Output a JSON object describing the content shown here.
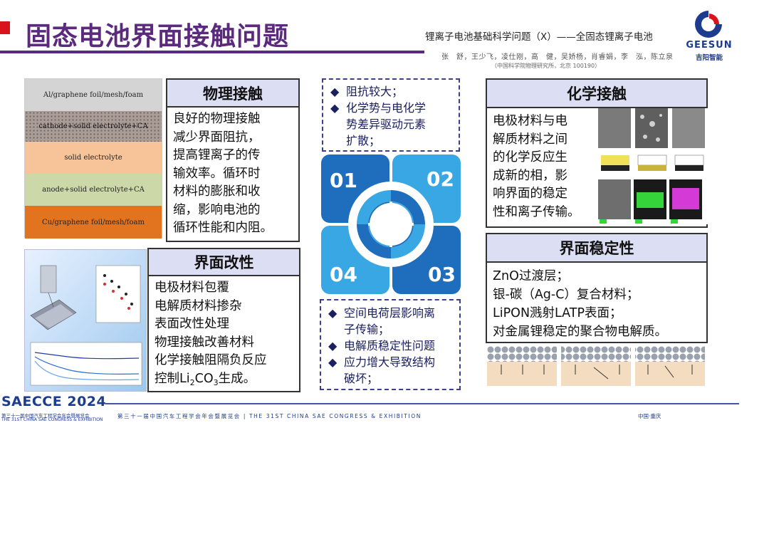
{
  "header": {
    "title": "固态电池界面接触问题",
    "paper_title": "锂离子电池基础科学问题（X）——全固态锂离子电池",
    "authors": "张　舒，王少飞，凌仕刚，高　健，吴娇杨，肖睿娟，李　泓，陈立泉",
    "affiliation": "（中国科学院物理研究所，北京 100190）"
  },
  "logo": {
    "name": "GEESUN",
    "cn": "吉阳智能",
    "colors": {
      "blue": "#1d3c8f",
      "red": "#d9141c"
    }
  },
  "layer_stack": {
    "layers": [
      "Al/graphene foil/mesh/foam",
      "cathode+solid electrolyte+CA",
      "solid electrolyte",
      "anode+solid electrolyte+CA",
      "Cu/graphene foil/mesh/foam"
    ]
  },
  "physical_contact": {
    "heading": "物理接触",
    "lines": [
      "良好的物理接触",
      "减少界面阻抗，",
      "提高锂离子的传",
      "输效率。循环时",
      "材料的膨胀和收",
      "缩，影响电池的",
      "循环性能和内阻。"
    ]
  },
  "surface_mod": {
    "heading": "界面改性",
    "lines": [
      "电极材料包覆",
      "电解质材料掺杂",
      "表面改性处理",
      "物理接触改善材料",
      "化学接触阻隔负反应"
    ],
    "last_line_prefix": "控制Li",
    "last_sub_2": "2",
    "last_mid": "CO",
    "last_sub_3": "3",
    "last_suffix": "生成。"
  },
  "top_issues": {
    "bullet": "◆",
    "items": [
      {
        "lines": [
          "阻抗较大；"
        ]
      },
      {
        "lines": [
          "化学势与电化学",
          "势差异驱动元素",
          "扩散；"
        ]
      }
    ]
  },
  "bottom_issues": {
    "bullet": "◆",
    "items": [
      {
        "lines": [
          "空间电荷层影响离",
          "子传输；"
        ]
      },
      {
        "lines": [
          "电解质稳定性问题"
        ]
      },
      {
        "lines": [
          "应力增大导致结构",
          "破坏；"
        ]
      }
    ]
  },
  "swirl": {
    "labels": [
      "01",
      "02",
      "03",
      "04"
    ],
    "colors": {
      "dark": "#1f6dbd",
      "light": "#39a7e3"
    }
  },
  "chemical_contact": {
    "heading": "化学接触",
    "lines": [
      "电极材料与电",
      "解质材料之间",
      "的化学反应生",
      "成新的相，影",
      "响界面的稳定",
      "性和离子传输。"
    ]
  },
  "interface_stability": {
    "heading": "界面稳定性",
    "lines": [
      "ZnO过渡层；",
      "银-碳（Ag-C）复合材料；",
      "LiPON溅射LATP表面；",
      "对金属锂稳定的聚合物电解质。"
    ]
  },
  "footer": {
    "brand": "SAECCE 2024",
    "brand_sub1": "第三十一届中国汽车工程学会年会暨展览会",
    "brand_sub2": "THE 31ST CHINA SAE CONGRESS & EXHIBITION",
    "congress": "第三十一届中国汽车工程学会年会暨展览会 | THE 31ST CHINA SAE CONGRESS & EXHIBITION",
    "city": "中国·重庆"
  }
}
